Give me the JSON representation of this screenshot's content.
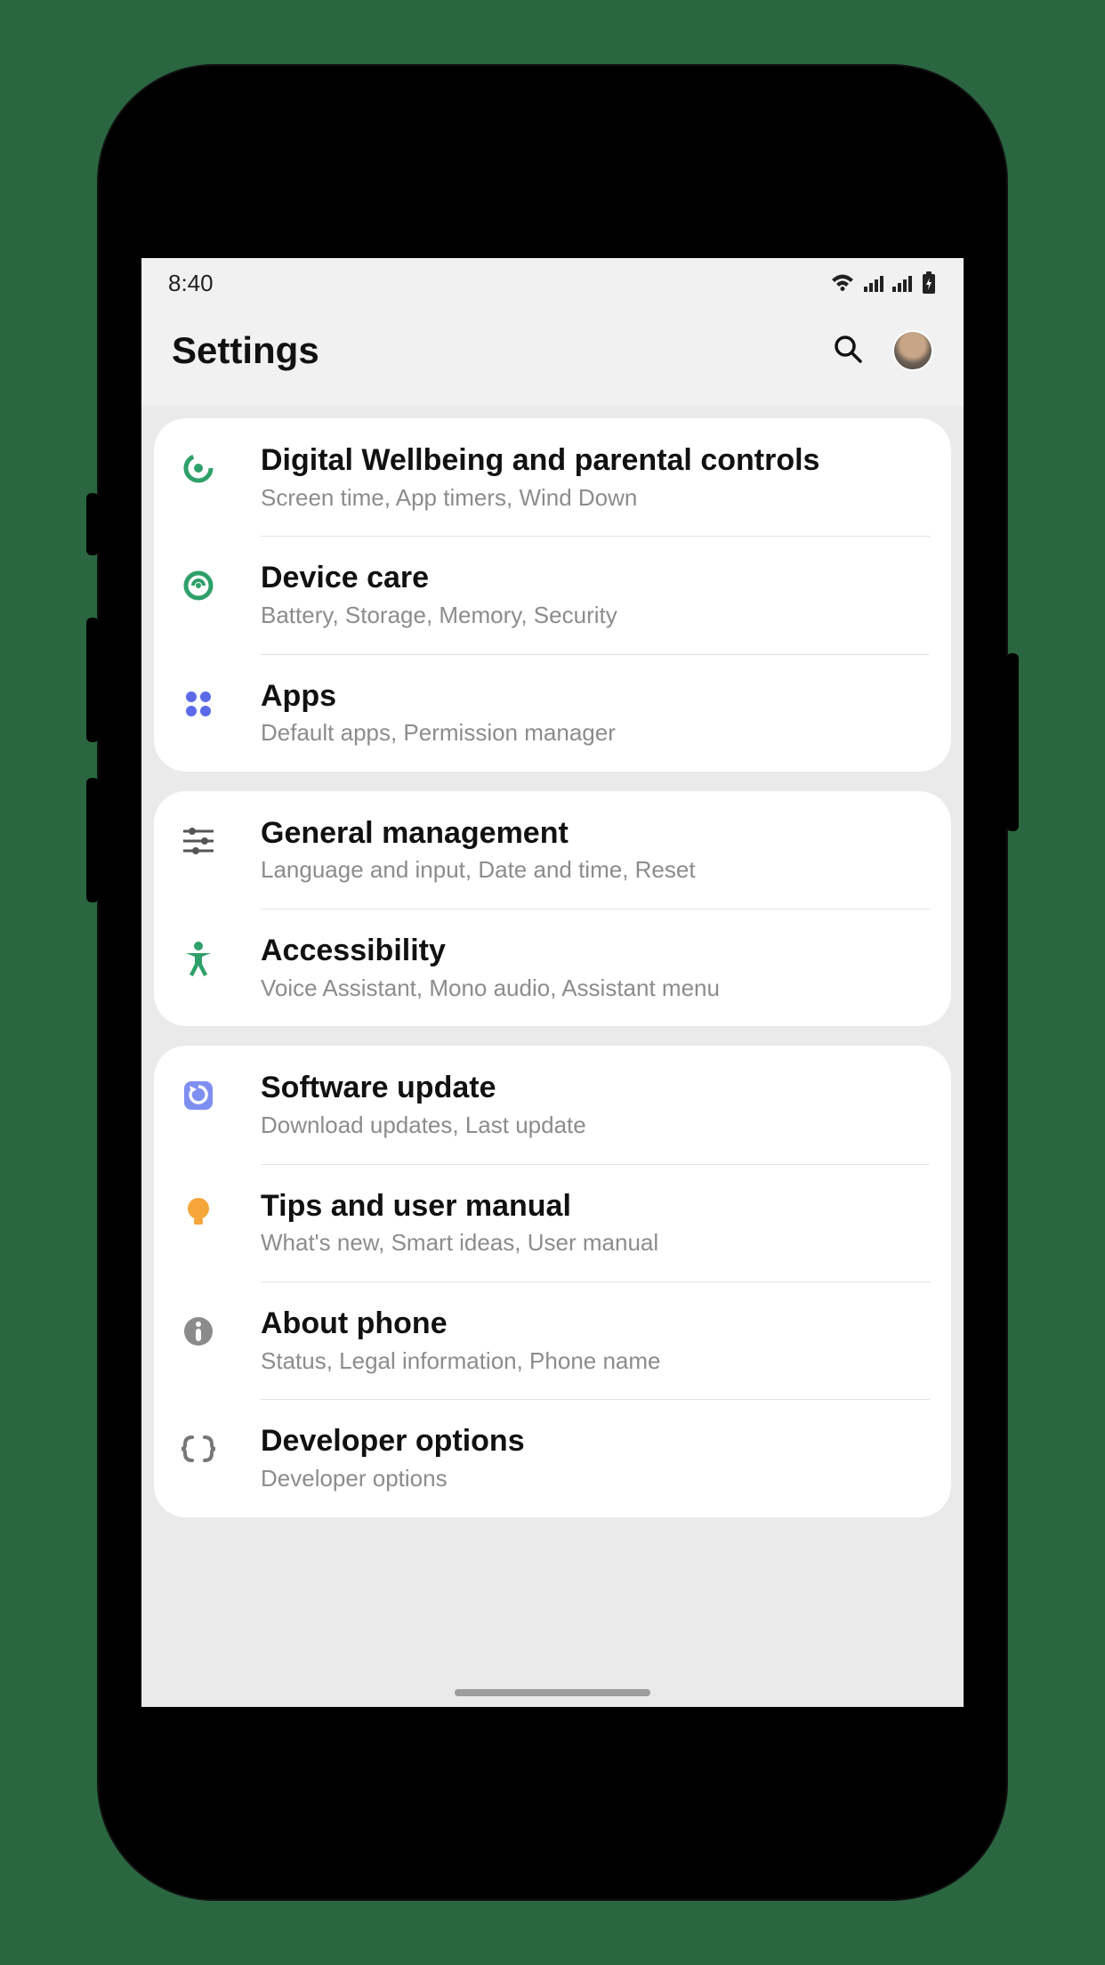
{
  "status": {
    "time": "8:40"
  },
  "header": {
    "title": "Settings"
  },
  "groups": [
    {
      "items": [
        {
          "icon": "wellbeing",
          "title": "Digital Wellbeing and parental controls",
          "sub": "Screen time, App timers, Wind Down"
        },
        {
          "icon": "devicecare",
          "title": "Device care",
          "sub": "Battery, Storage, Memory, Security"
        },
        {
          "icon": "apps",
          "title": "Apps",
          "sub": "Default apps, Permission manager"
        }
      ]
    },
    {
      "items": [
        {
          "icon": "sliders",
          "title": "General management",
          "sub": "Language and input, Date and time, Reset"
        },
        {
          "icon": "accessibility",
          "title": "Accessibility",
          "sub": "Voice Assistant, Mono audio, Assistant menu"
        }
      ]
    },
    {
      "items": [
        {
          "icon": "update",
          "title": "Software update",
          "sub": "Download updates, Last update"
        },
        {
          "icon": "bulb",
          "title": "Tips and user manual",
          "sub": "What's new, Smart ideas, User manual"
        },
        {
          "icon": "info",
          "title": "About phone",
          "sub": "Status, Legal information, Phone name"
        },
        {
          "icon": "braces",
          "title": "Developer options",
          "sub": "Developer options"
        }
      ]
    }
  ]
}
